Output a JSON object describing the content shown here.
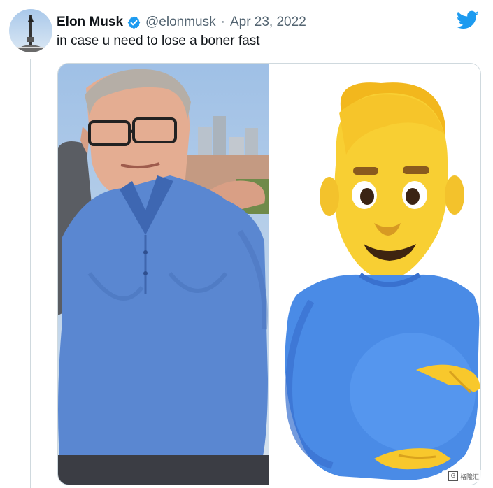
{
  "tweet": {
    "display_name": "Elon Musk",
    "handle": "@elonmusk",
    "separator": "·",
    "date": "Apr 23, 2022",
    "text": "in case u need to lose a boner fast",
    "verified_icon": "verified-badge-icon",
    "platform_icon": "twitter-bird-icon"
  },
  "media": {
    "left": "photo-man-blue-polo",
    "right": "pregnant-man-emoji"
  },
  "watermark": {
    "logo": "G",
    "text": "格隆汇"
  },
  "colors": {
    "name": "#0f1419",
    "secondary": "#536471",
    "twitter_blue": "#1d9bf0",
    "shirt_blue": "#5a87d1",
    "emoji_yellow": "#f8c82c",
    "emoji_shirt": "#4a8be6"
  }
}
